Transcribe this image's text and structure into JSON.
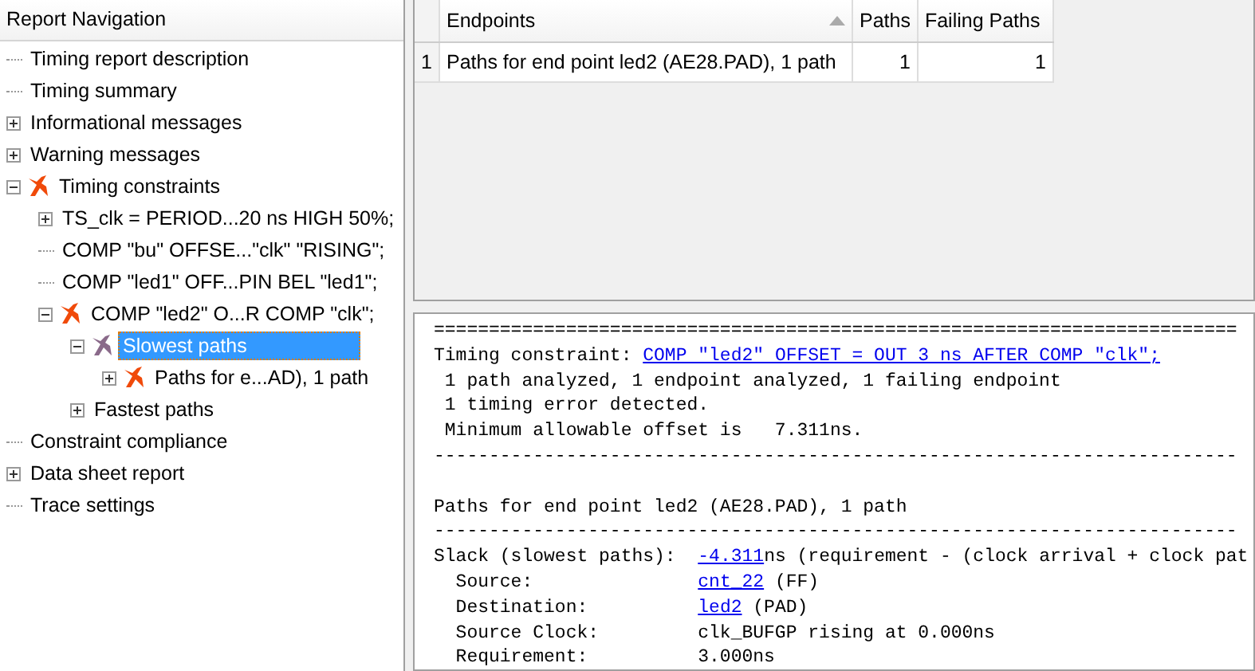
{
  "navigation": {
    "title": "Report Navigation",
    "tree": [
      {
        "label": "Timing report description",
        "selected": false
      },
      {
        "label": "Timing summary",
        "selected": false
      },
      {
        "label": "Informational messages",
        "selected": false,
        "expanded": false
      },
      {
        "label": "Warning messages",
        "selected": false,
        "expanded": false
      },
      {
        "label": "Timing constraints",
        "selected": false,
        "failed": true,
        "expanded": true,
        "children": [
          {
            "label": "TS_clk = PERIOD...20 ns HIGH 50%;",
            "selected": false,
            "expanded": false
          },
          {
            "label": "COMP \"bu\" OFFSE...\"clk\" \"RISING\";",
            "selected": false
          },
          {
            "label": "COMP \"led1\" OFF...PIN BEL \"led1\";",
            "selected": false
          },
          {
            "label": "COMP \"led2\" O...R COMP \"clk\";",
            "selected": false,
            "failed": true,
            "expanded": true,
            "children": [
              {
                "label": "Slowest paths",
                "selected": true,
                "failed": true,
                "expanded": true,
                "children": [
                  {
                    "label": "Paths for e...AD), 1 path",
                    "selected": false,
                    "failed": true,
                    "expanded": false
                  }
                ]
              },
              {
                "label": "Fastest paths",
                "selected": false,
                "expanded": false
              }
            ]
          }
        ]
      },
      {
        "label": "Constraint compliance",
        "selected": false
      },
      {
        "label": "Data sheet report",
        "selected": false,
        "expanded": false
      },
      {
        "label": "Trace settings",
        "selected": false
      }
    ]
  },
  "endpoints_table": {
    "columns": [
      "Endpoints",
      "Paths",
      "Failing Paths"
    ],
    "rows": [
      {
        "index": "1",
        "cells": [
          "Paths for end point led2 (AE28.PAD), 1 path",
          "1",
          "1"
        ]
      }
    ]
  },
  "report": {
    "lines": [
      {
        "kind": "text",
        "segments": [
          {
            "text": "=========================================================================",
            "link": false
          }
        ]
      },
      {
        "kind": "text",
        "segments": [
          {
            "text": "Timing constraint: ",
            "link": false
          },
          {
            "text": "COMP \"led2\" OFFSET = OUT 3 ns AFTER COMP \"clk\";",
            "link": true
          }
        ]
      },
      {
        "kind": "text",
        "segments": [
          {
            "text": " 1 path analyzed, 1 endpoint analyzed, 1 failing endpoint",
            "link": false
          }
        ]
      },
      {
        "kind": "text",
        "segments": [
          {
            "text": " 1 timing error detected.",
            "link": false
          }
        ]
      },
      {
        "kind": "text",
        "segments": [
          {
            "text": " Minimum allowable offset is   7.311ns.",
            "link": false
          }
        ]
      },
      {
        "kind": "text",
        "segments": [
          {
            "text": "-------------------------------------------------------------------------",
            "link": false
          }
        ]
      },
      {
        "kind": "blank"
      },
      {
        "kind": "text",
        "segments": [
          {
            "text": "Paths for end point led2 (AE28.PAD), 1 path",
            "link": false
          }
        ]
      },
      {
        "kind": "text",
        "segments": [
          {
            "text": "-------------------------------------------------------------------------",
            "link": false
          }
        ]
      },
      {
        "kind": "text",
        "segments": [
          {
            "text": "Slack (slowest paths):  ",
            "link": false
          },
          {
            "text": "-4.311",
            "link": true
          },
          {
            "text": "ns (requirement - (clock arrival + clock pat",
            "link": false
          }
        ]
      },
      {
        "kind": "text",
        "segments": [
          {
            "text": "  Source:               ",
            "link": false
          },
          {
            "text": "cnt_22",
            "link": true
          },
          {
            "text": " (FF)",
            "link": false
          }
        ]
      },
      {
        "kind": "text",
        "segments": [
          {
            "text": "  Destination:          ",
            "link": false
          },
          {
            "text": "led2",
            "link": true
          },
          {
            "text": " (PAD)",
            "link": false
          }
        ]
      },
      {
        "kind": "text",
        "segments": [
          {
            "text": "  Source Clock:         clk_BUFGP rising at 0.000ns",
            "link": false
          }
        ]
      },
      {
        "kind": "text",
        "segments": [
          {
            "text": "  Requirement:          3.000ns",
            "link": false
          }
        ]
      }
    ]
  }
}
